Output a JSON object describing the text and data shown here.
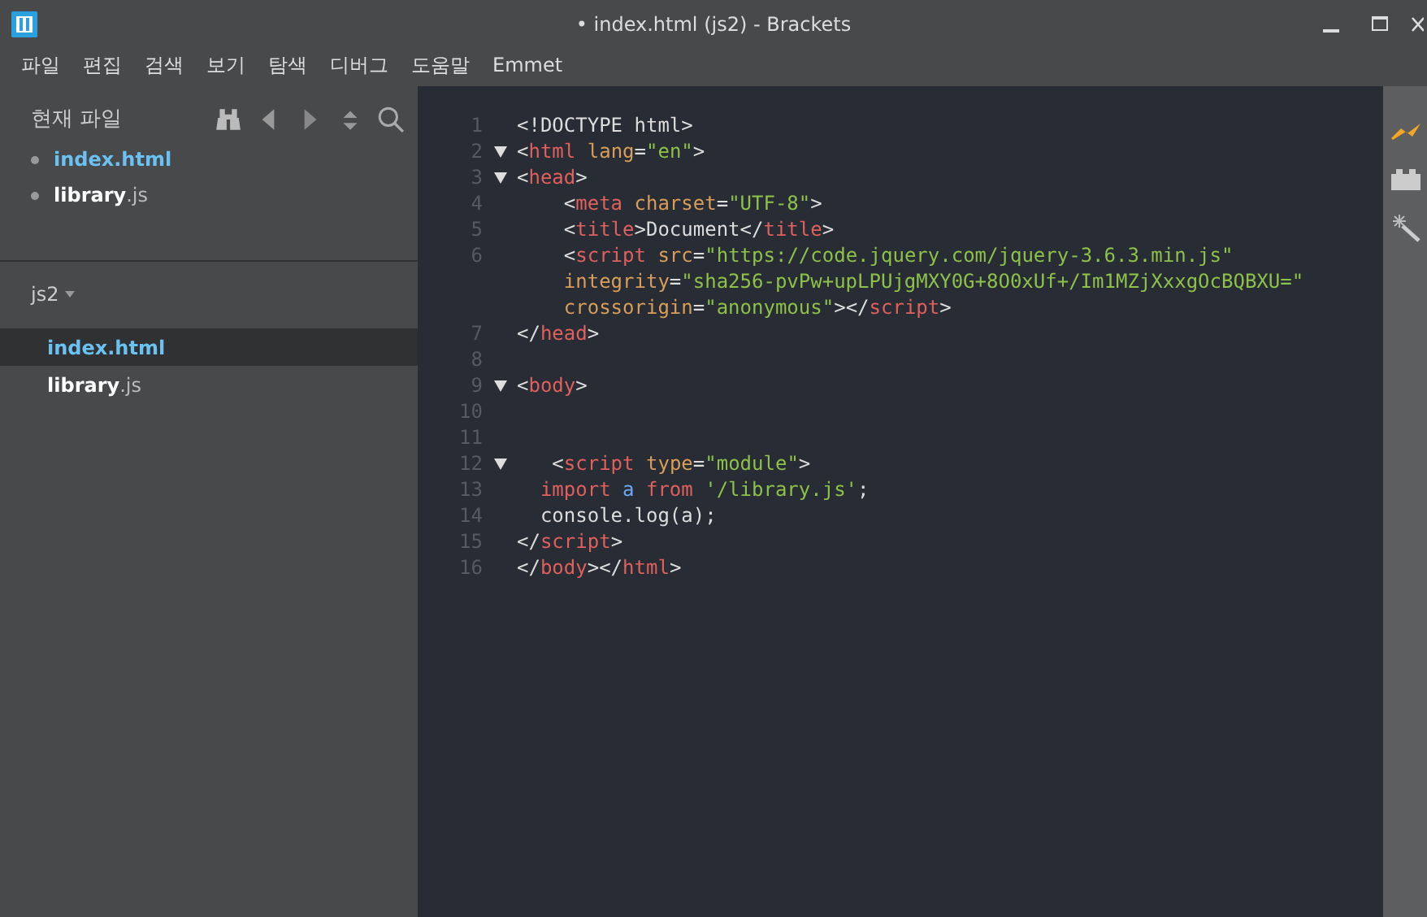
{
  "window": {
    "title": "• index.html (js2) - Brackets"
  },
  "menu": [
    "파일",
    "편집",
    "검색",
    "보기",
    "탐색",
    "디버그",
    "도움말",
    "Emmet"
  ],
  "sidebar": {
    "working_files_title": "현재 파일",
    "working_files": [
      {
        "name": "index.html",
        "selected": true
      },
      {
        "name": "library",
        "ext": ".js",
        "selected": false
      }
    ],
    "project": "js2",
    "project_files": [
      {
        "name": "index.html",
        "selected": true
      },
      {
        "name": "library",
        "ext": ".js",
        "selected": false
      }
    ]
  },
  "editor": {
    "lines": [
      {
        "number": "1",
        "foldable": false,
        "tokens": [
          {
            "kind": "plain",
            "text": "<!DOCTYPE html>"
          }
        ]
      },
      {
        "number": "2",
        "foldable": true,
        "tokens": [
          {
            "kind": "plain",
            "text": "<"
          },
          {
            "kind": "tag",
            "text": "html"
          },
          {
            "kind": "attr",
            "text": " lang"
          },
          {
            "kind": "plain",
            "text": "="
          },
          {
            "kind": "string",
            "text": "\"en\""
          },
          {
            "kind": "plain",
            "text": ">"
          }
        ]
      },
      {
        "number": "3",
        "foldable": true,
        "tokens": [
          {
            "kind": "plain",
            "text": "<"
          },
          {
            "kind": "tag",
            "text": "head"
          },
          {
            "kind": "plain",
            "text": ">"
          }
        ]
      },
      {
        "number": "4",
        "foldable": false,
        "tokens": [
          {
            "kind": "plain",
            "text": "    <"
          },
          {
            "kind": "tag",
            "text": "meta"
          },
          {
            "kind": "attr",
            "text": " charset"
          },
          {
            "kind": "plain",
            "text": "="
          },
          {
            "kind": "string",
            "text": "\"UTF-8\""
          },
          {
            "kind": "plain",
            "text": ">"
          }
        ]
      },
      {
        "number": "5",
        "foldable": false,
        "tokens": [
          {
            "kind": "plain",
            "text": "    <"
          },
          {
            "kind": "tag",
            "text": "title"
          },
          {
            "kind": "plain",
            "text": ">Document</"
          },
          {
            "kind": "tag",
            "text": "title"
          },
          {
            "kind": "plain",
            "text": ">"
          }
        ]
      },
      {
        "number": "6",
        "foldable": false,
        "tokens": [
          {
            "kind": "plain",
            "text": "    <"
          },
          {
            "kind": "tag",
            "text": "script"
          },
          {
            "kind": "attr",
            "text": " src"
          },
          {
            "kind": "plain",
            "text": "="
          },
          {
            "kind": "string",
            "text": "\"https://code.jquery.com/jquery-3.6.3.min.js\""
          }
        ],
        "wrapped": [
          {
            "tokens": [
              {
                "kind": "attr",
                "text": "    integrity"
              },
              {
                "kind": "plain",
                "text": "="
              },
              {
                "kind": "string",
                "text": "\"sha256-pvPw+upLPUjgMXY0G+8O0xUf+/Im1MZjXxxgOcBQBXU=\""
              }
            ]
          },
          {
            "tokens": [
              {
                "kind": "attr",
                "text": "    crossorigin"
              },
              {
                "kind": "plain",
                "text": "="
              },
              {
                "kind": "string",
                "text": "\"anonymous\""
              },
              {
                "kind": "plain",
                "text": "></"
              },
              {
                "kind": "tag",
                "text": "script"
              },
              {
                "kind": "plain",
                "text": ">"
              }
            ]
          }
        ]
      },
      {
        "number": "7",
        "foldable": false,
        "tokens": [
          {
            "kind": "plain",
            "text": "</"
          },
          {
            "kind": "tag",
            "text": "head"
          },
          {
            "kind": "plain",
            "text": ">"
          }
        ]
      },
      {
        "number": "8",
        "foldable": false
      },
      {
        "number": "9",
        "foldable": true,
        "tokens": [
          {
            "kind": "plain",
            "text": "<"
          },
          {
            "kind": "tag",
            "text": "body"
          },
          {
            "kind": "plain",
            "text": ">"
          }
        ]
      },
      {
        "number": "10",
        "foldable": false
      },
      {
        "number": "11",
        "foldable": false
      },
      {
        "number": "12",
        "foldable": true,
        "tokens": [
          {
            "kind": "plain",
            "text": "   <"
          },
          {
            "kind": "tag",
            "text": "script"
          },
          {
            "kind": "attr",
            "text": " type"
          },
          {
            "kind": "plain",
            "text": "="
          },
          {
            "kind": "string",
            "text": "\"module\""
          },
          {
            "kind": "plain",
            "text": ">"
          }
        ]
      },
      {
        "number": "13",
        "foldable": false,
        "tokens": [
          {
            "kind": "keyword",
            "text": "  import "
          },
          {
            "kind": "variable",
            "text": "a "
          },
          {
            "kind": "keyword",
            "text": "from "
          },
          {
            "kind": "string",
            "text": "'/library.js'"
          },
          {
            "kind": "plain",
            "text": ";"
          }
        ]
      },
      {
        "number": "14",
        "foldable": false,
        "tokens": [
          {
            "kind": "plain",
            "text": "  console.log(a);"
          }
        ]
      },
      {
        "number": "15",
        "foldable": false,
        "tokens": [
          {
            "kind": "plain",
            "text": "</"
          },
          {
            "kind": "tag",
            "text": "script"
          },
          {
            "kind": "plain",
            "text": ">"
          }
        ]
      },
      {
        "number": "16",
        "foldable": false,
        "tokens": [
          {
            "kind": "plain",
            "text": "</"
          },
          {
            "kind": "tag",
            "text": "body"
          },
          {
            "kind": "plain",
            "text": "></"
          },
          {
            "kind": "tag",
            "text": "html"
          },
          {
            "kind": "plain",
            "text": ">"
          }
        ]
      }
    ]
  }
}
